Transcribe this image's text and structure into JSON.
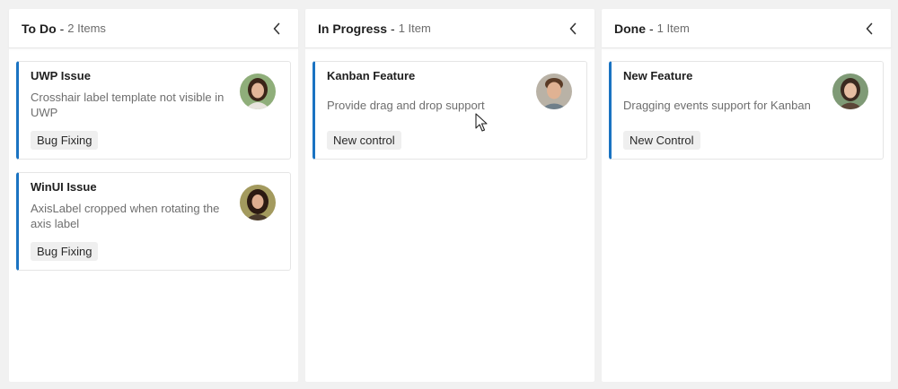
{
  "columns": [
    {
      "title": "To Do",
      "separator": "-",
      "count": "2 Items",
      "cards": [
        {
          "title": "UWP Issue",
          "description": "Crosshair label template not visible in UWP",
          "tag": "Bug Fixing"
        },
        {
          "title": "WinUI Issue",
          "description": "AxisLabel cropped when rotating the axis label",
          "tag": "Bug Fixing"
        }
      ]
    },
    {
      "title": "In Progress",
      "separator": "-",
      "count": "1 Item",
      "cards": [
        {
          "title": "Kanban Feature",
          "description": "Provide drag and drop support",
          "tag": "New control"
        }
      ]
    },
    {
      "title": "Done",
      "separator": "-",
      "count": "1 Item",
      "cards": [
        {
          "title": "New Feature",
          "description": "Dragging events support for Kanban",
          "tag": "New Control"
        }
      ]
    }
  ],
  "icons": {
    "collapse": "chevron-left-icon",
    "avatar": "user-avatar",
    "cursor": "mouse-pointer-icon"
  },
  "colors": {
    "card_accent": "#1a73c2",
    "background": "#f1f1f1",
    "tag_bg": "#efefef"
  }
}
